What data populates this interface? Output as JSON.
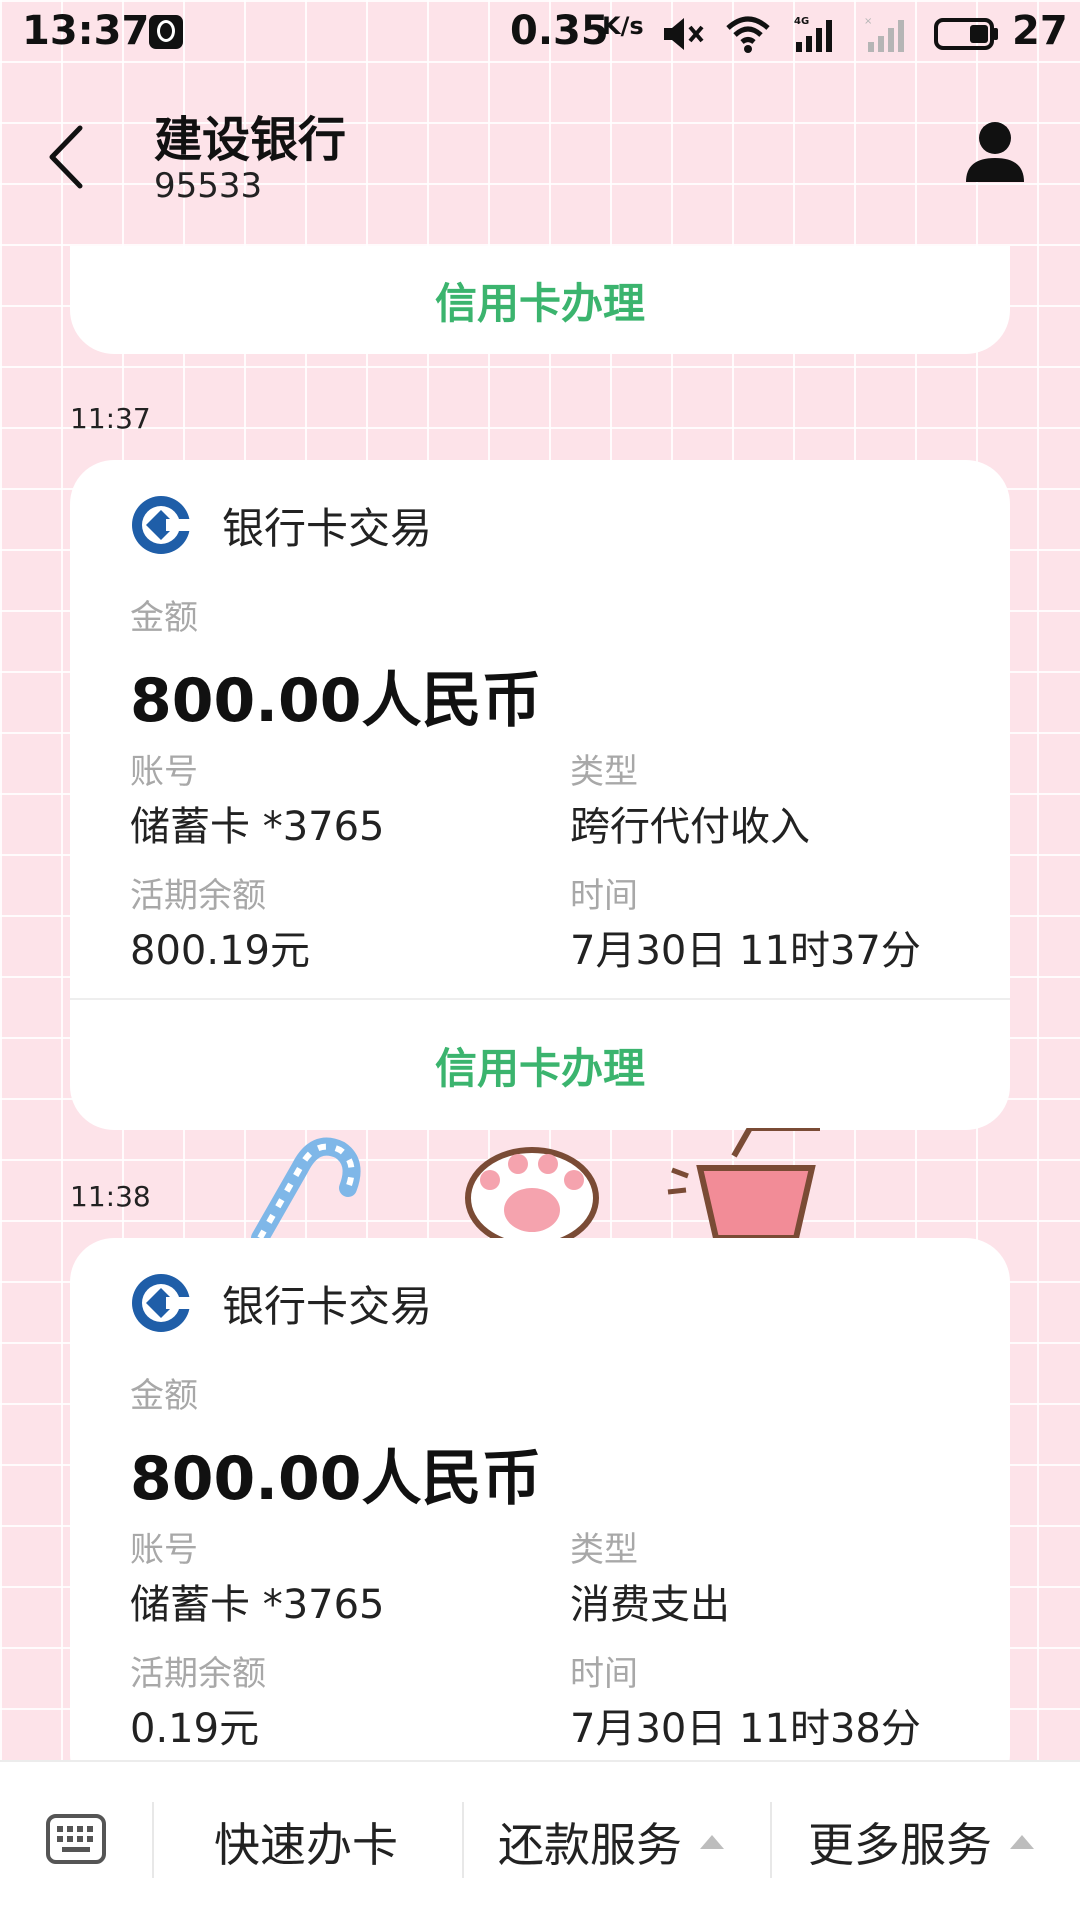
{
  "status_bar": {
    "time": "13:37",
    "speed_value": "0.35",
    "speed_unit": "K/s",
    "battery": "27",
    "icons": [
      "qq-icon",
      "mute-icon",
      "wifi-icon",
      "signal-4g-icon",
      "signal-empty-icon",
      "battery-icon"
    ]
  },
  "header": {
    "contact_name": "建设银行",
    "contact_number": "95533",
    "icons": [
      "back-icon",
      "profile-icon"
    ]
  },
  "messages": {
    "first_card": {
      "action_label": "信用卡办理"
    },
    "transactions": [
      {
        "timestamp": "11:37",
        "title": "银行卡交易",
        "amount_label": "金额",
        "amount": "800.00人民币",
        "account_label": "账号",
        "account": "储蓄卡 *3765",
        "type_label": "类型",
        "type": "跨行代付收入",
        "balance_label": "活期余额",
        "balance": "800.19元",
        "time_label": "时间",
        "time": "7月30日 11时37分",
        "action_label": "信用卡办理"
      },
      {
        "timestamp": "11:38",
        "title": "银行卡交易",
        "amount_label": "金额",
        "amount": "800.00人民币",
        "account_label": "账号",
        "account": "储蓄卡 *3765",
        "type_label": "类型",
        "type": "消费支出",
        "balance_label": "活期余额",
        "balance": "0.19元",
        "time_label": "时间",
        "time": "7月30日 11时38分"
      }
    ]
  },
  "bottom_bar": {
    "items": [
      {
        "label": "快速办卡",
        "has_arrow": false
      },
      {
        "label": "还款服务",
        "has_arrow": true
      },
      {
        "label": "更多服务",
        "has_arrow": true
      }
    ]
  },
  "colors": {
    "background": "#fde3e9",
    "action_green": "#3bb46e",
    "bank_logo_blue": "#1f5ea8",
    "label_gray": "#a8a8a8"
  }
}
